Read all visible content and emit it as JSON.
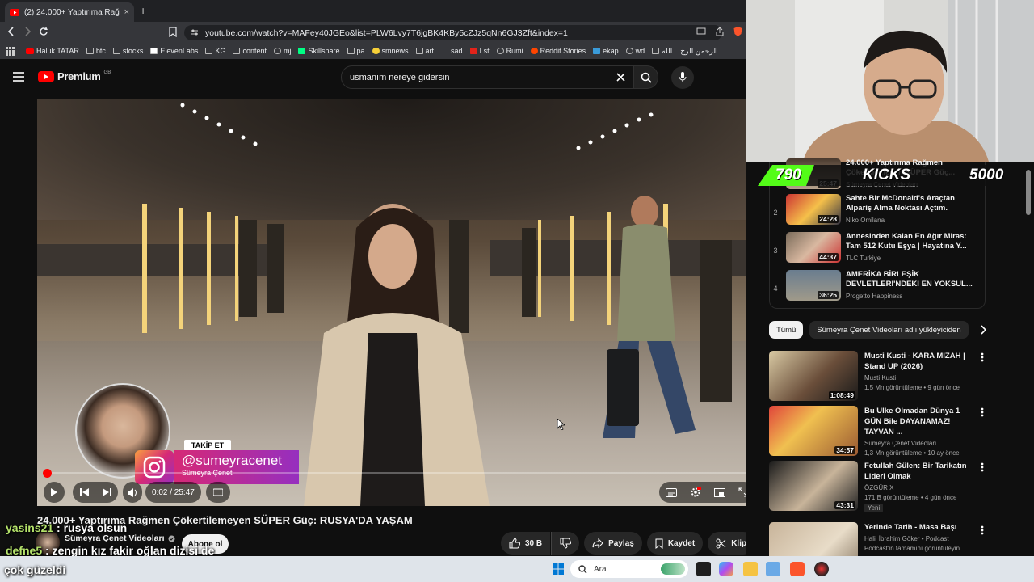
{
  "browser": {
    "tab_title": "(2) 24.000+ Yaptırıma Rağme",
    "url": "youtube.com/watch?v=MAFey40JGEo&list=PLW6Lvy7T6jgBK4KBy5cZJz5qNn6GJ3Zft&index=1",
    "bookmarks": [
      "Haluk TATAR",
      "btc",
      "stocks",
      "ElevenLabs",
      "KG",
      "content",
      "mj",
      "Skillshare",
      "pa",
      "smnews",
      "art",
      "sad",
      "Lst",
      "Rumi",
      "Reddit Stories",
      "ekap",
      "wd",
      "الرحمن الرح... الله"
    ]
  },
  "youtube": {
    "logo_text": "Premium",
    "logo_region": "GB",
    "search_value": "usmanım nereye gidersin"
  },
  "player": {
    "time": "0:02 / 25:47",
    "progress_fraction": 0.001
  },
  "overlay": {
    "follow_label": "TAKİP ET",
    "handle": "@sumeyracenet",
    "handle_sub": "Sümeyra Çenet",
    "chat": [
      {
        "user": "yasins21",
        "msg": " : rusya olsun"
      },
      {
        "user": "defne5",
        "msg": " : zengin kız fakir oğlan dizisi de"
      },
      {
        "user": "",
        "msg": "çok güzeldi"
      }
    ],
    "kicks_left": "790",
    "kicks_label": "KICKS",
    "kicks_right": "5000"
  },
  "video": {
    "title": "24.000+ Yaptırıma Rağmen Çökertilemeyen SÜPER Güç: RUSYA'DA YAŞAM",
    "channel": "Sümeyra Çenet Videoları",
    "subscribe_label": "Abone ol",
    "like_count": "30 B",
    "share_label": "Paylaş",
    "save_label": "Kaydet",
    "clip_label": "Klip"
  },
  "playlist": {
    "current": {
      "title": "24.000+ Yaptırıma Rağmen Çökertilemeyen SÜPER Güç...",
      "channel": "Sümeyra Çenet Videoları",
      "duration": "25:47"
    },
    "items": [
      {
        "index": "2",
        "title": "Sahte Bir McDonald's Araçtan Alpariş Alma Noktası Açtım.",
        "channel": "Niko Omilana",
        "duration": "24:28"
      },
      {
        "index": "3",
        "title": "Annesinden Kalan En Ağır Miras: Tam 512 Kutu Eşya | Hayatına Y...",
        "channel": "TLC Turkiye",
        "duration": "44:37"
      },
      {
        "index": "4",
        "title": "AMERİKA BİRLEŞİK DEVLETLERİ'NDEKİ EN YOKSUL...",
        "channel": "Progetto Happiness",
        "duration": "36:25"
      }
    ]
  },
  "chips": [
    "Tümü",
    "Sümeyra Çenet Videoları adlı yükleyiciden"
  ],
  "recommendations": [
    {
      "title": "Musti Kusti - KARA MİZAH | Stand UP (2026)",
      "channel": "Musti Kusti",
      "stats": "1,5 Mn görüntüleme • 9 gün önce",
      "duration": "1:08:49",
      "badge": ""
    },
    {
      "title": "Bu Ülke Olmadan Dünya 1 GÜN Bile DAYANAMAZ! TAYVAN ...",
      "channel": "Sümeyra Çenet Videoları",
      "stats": "1,3 Mn görüntüleme • 10 ay önce",
      "duration": "34:57",
      "badge": ""
    },
    {
      "title": "Fetullah Gülen: Bir Tarikatın Lideri Olmak",
      "channel": "ÖZGÜR X",
      "stats": "171 B görüntüleme • 4 gün önce",
      "duration": "43:31",
      "badge": "Yeni"
    },
    {
      "title": "Yerinde Tarih - Masa Başı",
      "channel": "Halil İbrahim Göker • Podcast",
      "stats": "Podcast'in tamamını görüntüleyin",
      "duration": "",
      "badge": ""
    }
  ],
  "taskbar": {
    "search_placeholder": "Ara"
  },
  "colors": {
    "youtube_red": "#ff0000",
    "kicks_green": "#53fc18"
  }
}
